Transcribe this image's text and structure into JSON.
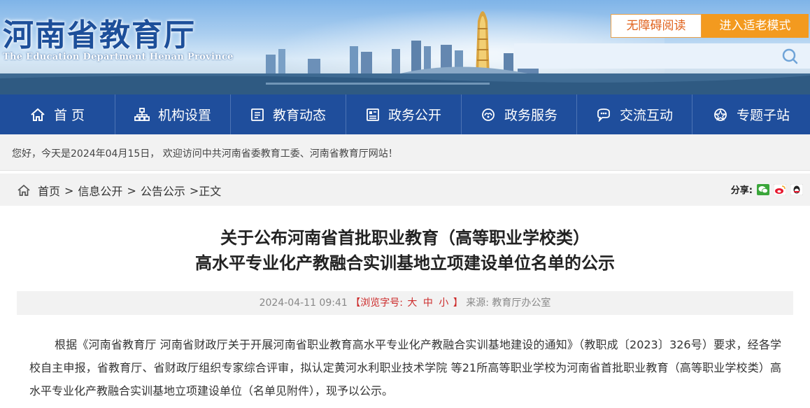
{
  "header": {
    "title": "河南省教育厅",
    "subtitle": "The Education Department Henan Province",
    "accessible_label": "无障碍阅读",
    "elder_label": "进入适老模式",
    "search_placeholder": ""
  },
  "nav": {
    "items": [
      {
        "label": "首 页",
        "icon": "home-icon"
      },
      {
        "label": "机构设置",
        "icon": "org-icon"
      },
      {
        "label": "教育动态",
        "icon": "news-icon"
      },
      {
        "label": "政务公开",
        "icon": "gov-open-icon"
      },
      {
        "label": "政务服务",
        "icon": "service-icon"
      },
      {
        "label": "交流互动",
        "icon": "interact-icon"
      },
      {
        "label": "专题子站",
        "icon": "topic-icon"
      }
    ]
  },
  "welcome": "您好，今天是2024年04月15日， 欢迎访问中共河南省委教育工委、河南省教育厅网站！",
  "breadcrumb": {
    "items": [
      "首页",
      "信息公开",
      "公告公示",
      "正文"
    ],
    "separator": ">"
  },
  "share": {
    "label": "分享:",
    "icons": [
      "wechat-icon",
      "weibo-icon",
      "qq-icon"
    ]
  },
  "article": {
    "title_line1": "关于公布河南省首批职业教育（高等职业学校类）",
    "title_line2": "高水平专业化产教融合实训基地立项建设单位名单的公示",
    "date": "2024-04-11 09:41",
    "font_size_open": "【浏览字号:",
    "size_large": "大",
    "size_medium": "中",
    "size_small": "小",
    "font_size_close": "】",
    "source": "来源: 教育厅办公室",
    "body": "根据《河南省教育厅 河南省财政厅关于开展河南省职业教育高水平专业化产教融合实训基地建设的通知》（教职成〔2023〕326号）要求，经各学校自主申报，省教育厅、省财政厅组织专家综合评审，拟认定黄河水利职业技术学院 等21所高等职业学校为河南省首批职业教育（高等职业学校类）高水平专业化产教融合实训基地立项建设单位（名单见附件），现予以公示。"
  },
  "colors": {
    "nav_bg": "#1f4e9c",
    "elder_btn": "#f39a1f",
    "accent_red": "#cc2a2a",
    "title_blue": "#1d4f9a"
  }
}
